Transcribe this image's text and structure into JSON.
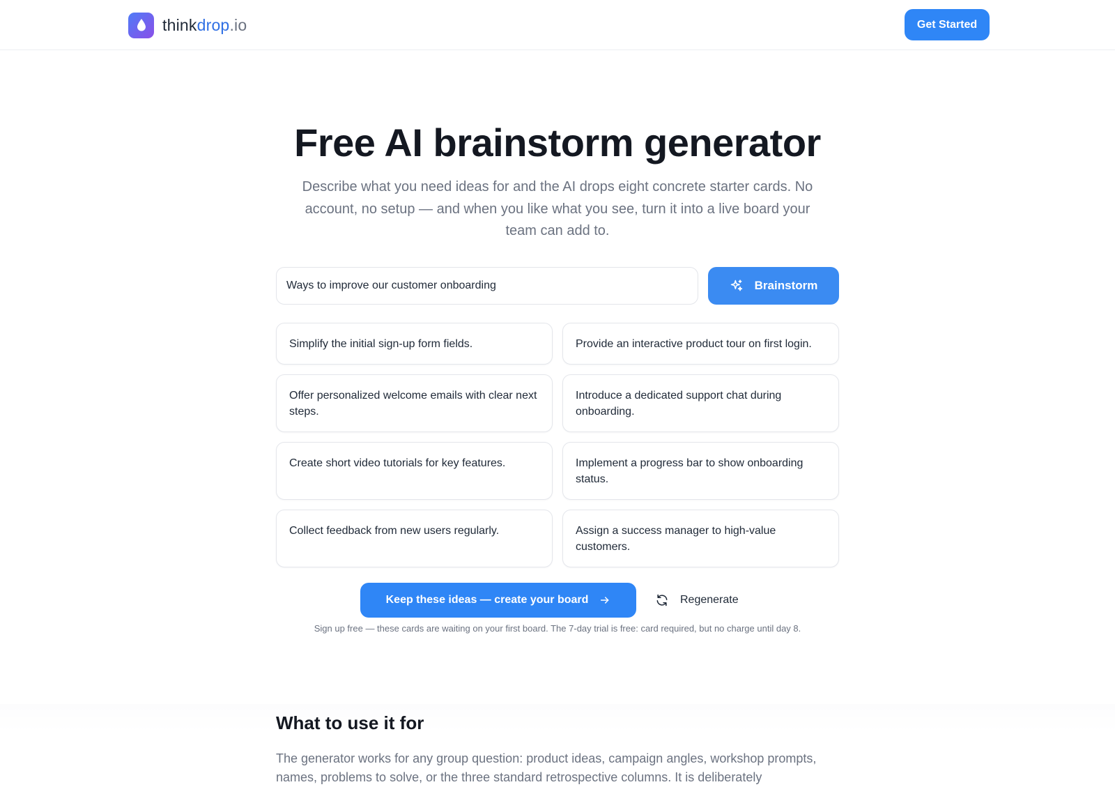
{
  "header": {
    "logo": {
      "part1": "think",
      "part2": "drop",
      "part3": ".io"
    },
    "cta_label": "Get Started"
  },
  "hero": {
    "title": "Free AI brainstorm generator",
    "subtitle": "Describe what you need ideas for and the AI drops eight concrete starter cards. No account, no setup — and when you like what you see, turn it into a live board your team can add to."
  },
  "prompt": {
    "value": "Ways to improve our customer onboarding",
    "button_label": "Brainstorm"
  },
  "cards": [
    "Simplify the initial sign-up form fields.",
    "Provide an interactive product tour on first login.",
    "Offer personalized welcome emails with clear next steps.",
    "Introduce a dedicated support chat during onboarding.",
    "Create short video tutorials for key features.",
    "Implement a progress bar to show onboarding status.",
    "Collect feedback from new users regularly.",
    "Assign a success manager to high-value customers."
  ],
  "actions": {
    "keep_label": "Keep these ideas — create your board",
    "regenerate_label": "Regenerate",
    "fineprint": "Sign up free — these cards are waiting on your first board. The 7-day trial is free: card required, but no charge until day 8."
  },
  "section": {
    "title": "What to use it for",
    "body": "The generator works for any group question: product ideas, campaign angles, workshop prompts, names, problems to solve, or the three standard retrospective columns. It is deliberately"
  },
  "colors": {
    "primary": "#2f86f6",
    "brainstorm": "#3b8bf2",
    "text": "#141821",
    "muted": "#6b7280",
    "border": "#e4e6eb"
  }
}
